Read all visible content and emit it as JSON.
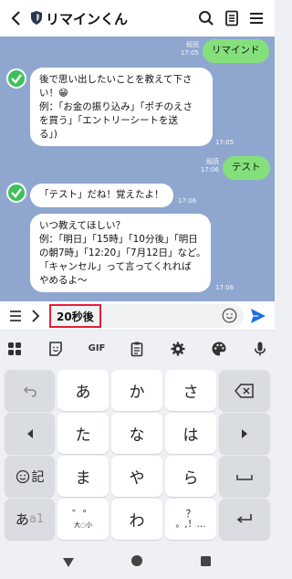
{
  "header": {
    "title": "リマインくん"
  },
  "chat": {
    "messages": [
      {
        "side": "out",
        "text": "リマインド",
        "read": "既読",
        "time": "17:05"
      },
      {
        "side": "in",
        "lines": [
          "後で思い出したいことを教えて下さ",
          "い！😁",
          "例：「お金の振り込み」「ポチのえさ",
          "を買う」「エントリーシートを送",
          "る」)"
        ],
        "time": "17:05"
      },
      {
        "side": "out",
        "text": "テスト",
        "read": "既読",
        "time": "17:06"
      },
      {
        "side": "in",
        "lines": [
          "「テスト」だね！覚えたよ！"
        ],
        "time": "17:06"
      },
      {
        "side": "in",
        "lines": [
          "いつ教えてほしい？",
          "例：「明日」「15時」「10分後」「明日",
          "の朝7時」「12:20」「7月12日」など。",
          "「キャンセル」って言ってくれれば",
          "やめるよ〜"
        ],
        "time": "17:06"
      }
    ]
  },
  "input": {
    "value": "20秒後"
  },
  "keyboard": {
    "toolbar": {
      "gif_label": "GIF"
    },
    "keys": {
      "a": "あ",
      "ka": "か",
      "sa": "さ",
      "ta": "た",
      "na": "な",
      "ha": "は",
      "ma": "ま",
      "ya": "や",
      "ra": "ら",
      "wa": "わ",
      "emoji_ki": "記",
      "mode_a": "あ",
      "mode_a1": "a1",
      "dakuten_top": "゛゜",
      "dakuten_bottom": "大◌小",
      "punct_top": "？",
      "punct_bottom": "。,！…"
    }
  },
  "colors": {
    "chat_bg": "#8fa7cf",
    "out_bubble": "#84e07b",
    "send": "#1f6fe0",
    "highlight": "#e42038"
  }
}
